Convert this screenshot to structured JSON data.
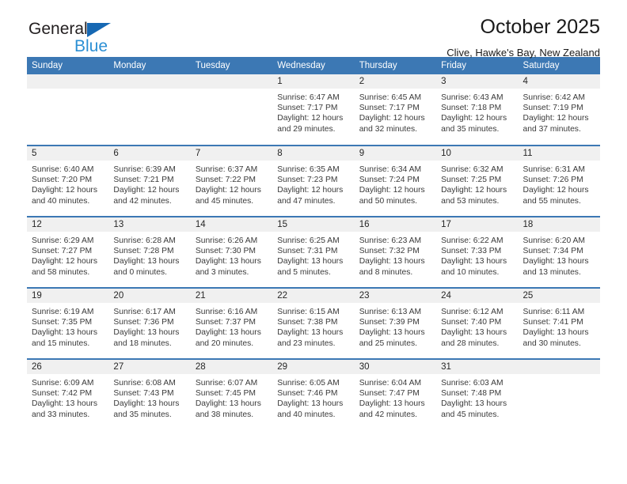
{
  "brand": {
    "name_top": "General",
    "name_bottom": "Blue",
    "triangle_icon": "triangle-icon",
    "color_dark": "#231f20",
    "color_blue": "#2b8fd4",
    "accent": "#1668b3"
  },
  "header": {
    "title": "October 2025",
    "subtitle": "Clive, Hawke's Bay, New Zealand"
  },
  "theme": {
    "header_row_bg": "#3c78b4",
    "daynum_bg": "#f0f0f0",
    "text": "#3a3a3a"
  },
  "weekday_headers": [
    "Sunday",
    "Monday",
    "Tuesday",
    "Wednesday",
    "Thursday",
    "Friday",
    "Saturday"
  ],
  "weeks": [
    [
      {
        "day": "",
        "empty": true,
        "sunrise": "",
        "sunset": "",
        "daylight_1": "",
        "daylight_2": ""
      },
      {
        "day": "",
        "empty": true,
        "sunrise": "",
        "sunset": "",
        "daylight_1": "",
        "daylight_2": ""
      },
      {
        "day": "",
        "empty": true,
        "sunrise": "",
        "sunset": "",
        "daylight_1": "",
        "daylight_2": ""
      },
      {
        "day": "1",
        "empty": false,
        "sunrise": "Sunrise: 6:47 AM",
        "sunset": "Sunset: 7:17 PM",
        "daylight_1": "Daylight: 12 hours",
        "daylight_2": "and 29 minutes."
      },
      {
        "day": "2",
        "empty": false,
        "sunrise": "Sunrise: 6:45 AM",
        "sunset": "Sunset: 7:17 PM",
        "daylight_1": "Daylight: 12 hours",
        "daylight_2": "and 32 minutes."
      },
      {
        "day": "3",
        "empty": false,
        "sunrise": "Sunrise: 6:43 AM",
        "sunset": "Sunset: 7:18 PM",
        "daylight_1": "Daylight: 12 hours",
        "daylight_2": "and 35 minutes."
      },
      {
        "day": "4",
        "empty": false,
        "sunrise": "Sunrise: 6:42 AM",
        "sunset": "Sunset: 7:19 PM",
        "daylight_1": "Daylight: 12 hours",
        "daylight_2": "and 37 minutes."
      }
    ],
    [
      {
        "day": "5",
        "empty": false,
        "sunrise": "Sunrise: 6:40 AM",
        "sunset": "Sunset: 7:20 PM",
        "daylight_1": "Daylight: 12 hours",
        "daylight_2": "and 40 minutes."
      },
      {
        "day": "6",
        "empty": false,
        "sunrise": "Sunrise: 6:39 AM",
        "sunset": "Sunset: 7:21 PM",
        "daylight_1": "Daylight: 12 hours",
        "daylight_2": "and 42 minutes."
      },
      {
        "day": "7",
        "empty": false,
        "sunrise": "Sunrise: 6:37 AM",
        "sunset": "Sunset: 7:22 PM",
        "daylight_1": "Daylight: 12 hours",
        "daylight_2": "and 45 minutes."
      },
      {
        "day": "8",
        "empty": false,
        "sunrise": "Sunrise: 6:35 AM",
        "sunset": "Sunset: 7:23 PM",
        "daylight_1": "Daylight: 12 hours",
        "daylight_2": "and 47 minutes."
      },
      {
        "day": "9",
        "empty": false,
        "sunrise": "Sunrise: 6:34 AM",
        "sunset": "Sunset: 7:24 PM",
        "daylight_1": "Daylight: 12 hours",
        "daylight_2": "and 50 minutes."
      },
      {
        "day": "10",
        "empty": false,
        "sunrise": "Sunrise: 6:32 AM",
        "sunset": "Sunset: 7:25 PM",
        "daylight_1": "Daylight: 12 hours",
        "daylight_2": "and 53 minutes."
      },
      {
        "day": "11",
        "empty": false,
        "sunrise": "Sunrise: 6:31 AM",
        "sunset": "Sunset: 7:26 PM",
        "daylight_1": "Daylight: 12 hours",
        "daylight_2": "and 55 minutes."
      }
    ],
    [
      {
        "day": "12",
        "empty": false,
        "sunrise": "Sunrise: 6:29 AM",
        "sunset": "Sunset: 7:27 PM",
        "daylight_1": "Daylight: 12 hours",
        "daylight_2": "and 58 minutes."
      },
      {
        "day": "13",
        "empty": false,
        "sunrise": "Sunrise: 6:28 AM",
        "sunset": "Sunset: 7:28 PM",
        "daylight_1": "Daylight: 13 hours",
        "daylight_2": "and 0 minutes."
      },
      {
        "day": "14",
        "empty": false,
        "sunrise": "Sunrise: 6:26 AM",
        "sunset": "Sunset: 7:30 PM",
        "daylight_1": "Daylight: 13 hours",
        "daylight_2": "and 3 minutes."
      },
      {
        "day": "15",
        "empty": false,
        "sunrise": "Sunrise: 6:25 AM",
        "sunset": "Sunset: 7:31 PM",
        "daylight_1": "Daylight: 13 hours",
        "daylight_2": "and 5 minutes."
      },
      {
        "day": "16",
        "empty": false,
        "sunrise": "Sunrise: 6:23 AM",
        "sunset": "Sunset: 7:32 PM",
        "daylight_1": "Daylight: 13 hours",
        "daylight_2": "and 8 minutes."
      },
      {
        "day": "17",
        "empty": false,
        "sunrise": "Sunrise: 6:22 AM",
        "sunset": "Sunset: 7:33 PM",
        "daylight_1": "Daylight: 13 hours",
        "daylight_2": "and 10 minutes."
      },
      {
        "day": "18",
        "empty": false,
        "sunrise": "Sunrise: 6:20 AM",
        "sunset": "Sunset: 7:34 PM",
        "daylight_1": "Daylight: 13 hours",
        "daylight_2": "and 13 minutes."
      }
    ],
    [
      {
        "day": "19",
        "empty": false,
        "sunrise": "Sunrise: 6:19 AM",
        "sunset": "Sunset: 7:35 PM",
        "daylight_1": "Daylight: 13 hours",
        "daylight_2": "and 15 minutes."
      },
      {
        "day": "20",
        "empty": false,
        "sunrise": "Sunrise: 6:17 AM",
        "sunset": "Sunset: 7:36 PM",
        "daylight_1": "Daylight: 13 hours",
        "daylight_2": "and 18 minutes."
      },
      {
        "day": "21",
        "empty": false,
        "sunrise": "Sunrise: 6:16 AM",
        "sunset": "Sunset: 7:37 PM",
        "daylight_1": "Daylight: 13 hours",
        "daylight_2": "and 20 minutes."
      },
      {
        "day": "22",
        "empty": false,
        "sunrise": "Sunrise: 6:15 AM",
        "sunset": "Sunset: 7:38 PM",
        "daylight_1": "Daylight: 13 hours",
        "daylight_2": "and 23 minutes."
      },
      {
        "day": "23",
        "empty": false,
        "sunrise": "Sunrise: 6:13 AM",
        "sunset": "Sunset: 7:39 PM",
        "daylight_1": "Daylight: 13 hours",
        "daylight_2": "and 25 minutes."
      },
      {
        "day": "24",
        "empty": false,
        "sunrise": "Sunrise: 6:12 AM",
        "sunset": "Sunset: 7:40 PM",
        "daylight_1": "Daylight: 13 hours",
        "daylight_2": "and 28 minutes."
      },
      {
        "day": "25",
        "empty": false,
        "sunrise": "Sunrise: 6:11 AM",
        "sunset": "Sunset: 7:41 PM",
        "daylight_1": "Daylight: 13 hours",
        "daylight_2": "and 30 minutes."
      }
    ],
    [
      {
        "day": "26",
        "empty": false,
        "sunrise": "Sunrise: 6:09 AM",
        "sunset": "Sunset: 7:42 PM",
        "daylight_1": "Daylight: 13 hours",
        "daylight_2": "and 33 minutes."
      },
      {
        "day": "27",
        "empty": false,
        "sunrise": "Sunrise: 6:08 AM",
        "sunset": "Sunset: 7:43 PM",
        "daylight_1": "Daylight: 13 hours",
        "daylight_2": "and 35 minutes."
      },
      {
        "day": "28",
        "empty": false,
        "sunrise": "Sunrise: 6:07 AM",
        "sunset": "Sunset: 7:45 PM",
        "daylight_1": "Daylight: 13 hours",
        "daylight_2": "and 38 minutes."
      },
      {
        "day": "29",
        "empty": false,
        "sunrise": "Sunrise: 6:05 AM",
        "sunset": "Sunset: 7:46 PM",
        "daylight_1": "Daylight: 13 hours",
        "daylight_2": "and 40 minutes."
      },
      {
        "day": "30",
        "empty": false,
        "sunrise": "Sunrise: 6:04 AM",
        "sunset": "Sunset: 7:47 PM",
        "daylight_1": "Daylight: 13 hours",
        "daylight_2": "and 42 minutes."
      },
      {
        "day": "31",
        "empty": false,
        "sunrise": "Sunrise: 6:03 AM",
        "sunset": "Sunset: 7:48 PM",
        "daylight_1": "Daylight: 13 hours",
        "daylight_2": "and 45 minutes."
      },
      {
        "day": "",
        "empty": true,
        "sunrise": "",
        "sunset": "",
        "daylight_1": "",
        "daylight_2": ""
      }
    ]
  ]
}
